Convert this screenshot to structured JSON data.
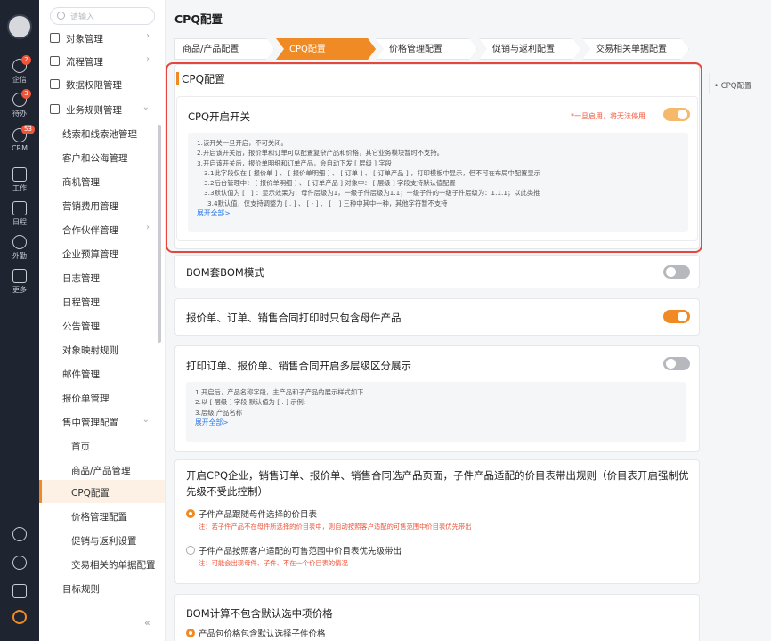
{
  "rail": {
    "items": [
      {
        "label": "企信",
        "badge": "2"
      },
      {
        "label": "待办",
        "badge": "3"
      },
      {
        "label": "CRM",
        "badge": "53"
      },
      {
        "label": "工作",
        "badge": ""
      },
      {
        "label": "日程",
        "badge": ""
      },
      {
        "label": "外勤",
        "badge": ""
      },
      {
        "label": "更多",
        "badge": ""
      }
    ]
  },
  "menu": {
    "search_placeholder": "请输入",
    "items": [
      {
        "label": "对象管理",
        "arrow": "›"
      },
      {
        "label": "流程管理",
        "arrow": "›"
      },
      {
        "label": "数据权限管理",
        "arrow": ""
      },
      {
        "label": "业务规则管理",
        "arrow": "⌄"
      },
      {
        "label": "线索和线索池管理",
        "arrow": ""
      },
      {
        "label": "客户和公海管理",
        "arrow": ""
      },
      {
        "label": "商机管理",
        "arrow": ""
      },
      {
        "label": "营销费用管理",
        "arrow": ""
      },
      {
        "label": "合作伙伴管理",
        "arrow": "›"
      },
      {
        "label": "企业预算管理",
        "arrow": ""
      },
      {
        "label": "日志管理",
        "arrow": ""
      },
      {
        "label": "日程管理",
        "arrow": ""
      },
      {
        "label": "公告管理",
        "arrow": ""
      },
      {
        "label": "对象映射规则",
        "arrow": ""
      },
      {
        "label": "邮件管理",
        "arrow": ""
      },
      {
        "label": "报价单管理",
        "arrow": ""
      },
      {
        "label": "售中管理配置",
        "arrow": "⌄"
      },
      {
        "label": "首页",
        "arrow": ""
      },
      {
        "label": "商品/产品管理",
        "arrow": ""
      },
      {
        "label": "CPQ配置",
        "arrow": ""
      },
      {
        "label": "价格管理配置",
        "arrow": ""
      },
      {
        "label": "促销与返利设置",
        "arrow": ""
      },
      {
        "label": "交易相关的单据配置",
        "arrow": ""
      },
      {
        "label": "目标规则",
        "arrow": ""
      }
    ],
    "collapse": "«"
  },
  "main": {
    "title": "CPQ配置",
    "tabs": [
      "商品/产品配置",
      "CPQ配置",
      "价格管理配置",
      "促销与返利配置",
      "交易相关单据配置"
    ],
    "anchor": "• CPQ配置",
    "section_title": "CPQ配置",
    "cpq_switch": {
      "title": "CPQ开启开关",
      "warning": "*一旦启用，将无法停用",
      "lines": [
        "1.该开关一旦开启，不可关闭。",
        "2.开启该开关后，报价单和订单可以配置复杂产品和价格，其它业务模块暂时不支持。",
        "3.开启该开关后，报价单明细和订单产品，会自动下发 [ 层级 ] 字段",
        "3.1此字段仅在 [ 报价单 ] 、 [ 报价单明细 ] 、 [ 订单 ] 、 [ 订单产品 ] ，打印模板中显示，但不可在布局中配置显示",
        "3.2后台管理中： [ 报价单明细 ] 、 [ 订单产品 ] 对象中： [ 层级 ] 字段支持默认值配置",
        "3.3默认值为 [ . ] ：显示效果为：母件层级为1，一级子件层级为1.1；一级子件的一级子件层级为：1.1.1；以此类推",
        "3.4默认值，仅支持调整为 [ . ] 、 [ - ] 、 [ _ ] 三种中其中一种，其他字符暂不支持"
      ],
      "more": "展开全部>"
    },
    "bom": {
      "title": "BOM套BOM模式"
    },
    "print_parent": {
      "title": "报价单、订单、销售合同打印时只包含母件产品"
    },
    "multi_level": {
      "title": "打印订单、报价单、销售合同开启多层级区分展示",
      "lines": [
        "1.开启后，产品名称字段，主产品和子产品的展示样式如下",
        "2.以 [ 层级 ] 字段 默认值为 [ . ] 示例:",
        "3.层级 产品名称"
      ],
      "more": "展开全部>"
    },
    "price_rule": {
      "title": "开启CPQ企业，销售订单、报价单、销售合同选产品页面，子件产品适配的价目表带出规则（价目表开启强制优先级不受此控制）",
      "options": [
        {
          "label": "子件产品跟随母件选择的价目表",
          "hint": "注：若子件产品不在母件所选择的价目表中，则自动按照客户适配的可售范围中价目表优先带出"
        },
        {
          "label": "子件产品按照客户适配的可售范围中价目表优先级带出",
          "hint": "注：可能会出现母件、子件、不在一个价目表的情况"
        }
      ]
    },
    "bom_price": {
      "title": "BOM计算不包含默认选中项价格",
      "option": "产品包价格包含默认选择子件价格"
    }
  }
}
